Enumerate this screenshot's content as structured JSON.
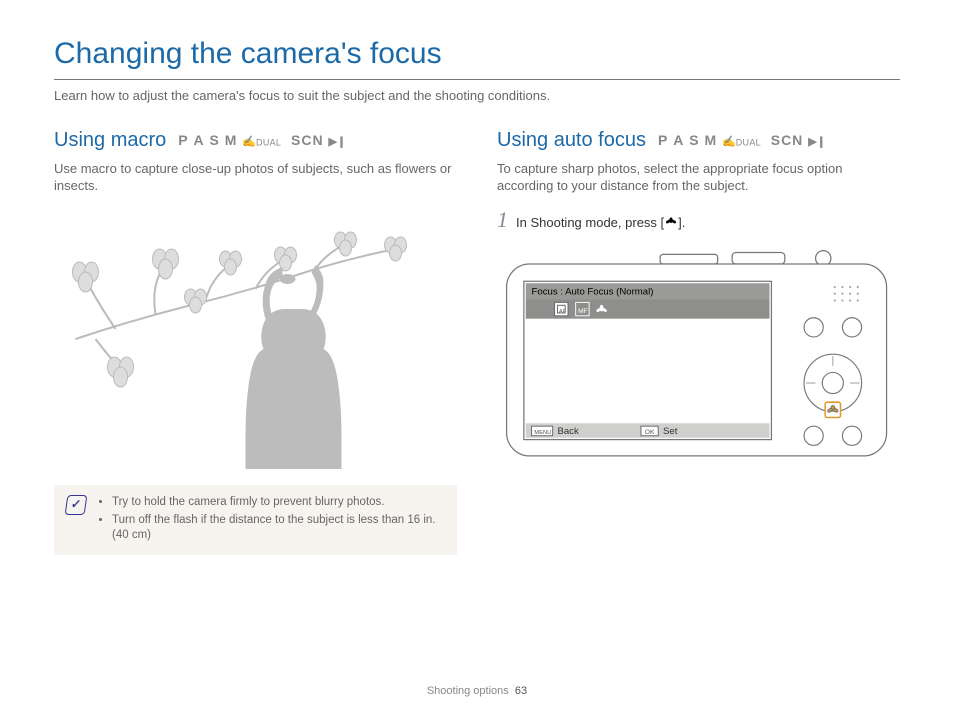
{
  "page": {
    "title": "Changing the camera's focus",
    "intro": "Learn how to adjust the camera's focus to suit the subject and the shooting conditions."
  },
  "modes": {
    "p": "P",
    "a": "A",
    "s": "S",
    "m": "M",
    "dual": "DUAL",
    "scn": "SCN"
  },
  "left": {
    "heading": "Using macro",
    "body": "Use macro to capture close-up photos of subjects, such as flowers or insects.",
    "notes": [
      "Try to hold the camera firmly to prevent blurry photos.",
      "Turn off the flash if the distance to the subject is less than 16 in. (40 cm)"
    ]
  },
  "right": {
    "heading": "Using auto focus",
    "body": "To capture sharp photos, select the appropriate focus option according to your distance from the subject.",
    "step1_num": "1",
    "step1_text_a": "In Shooting mode, press [",
    "step1_text_b": "].",
    "screen_title": "Focus : Auto Focus (Normal)",
    "screen_back": "Back",
    "screen_set": "Set",
    "screen_menu": "MENU",
    "screen_ok": "OK"
  },
  "footer": {
    "section": "Shooting options",
    "page": "63"
  }
}
